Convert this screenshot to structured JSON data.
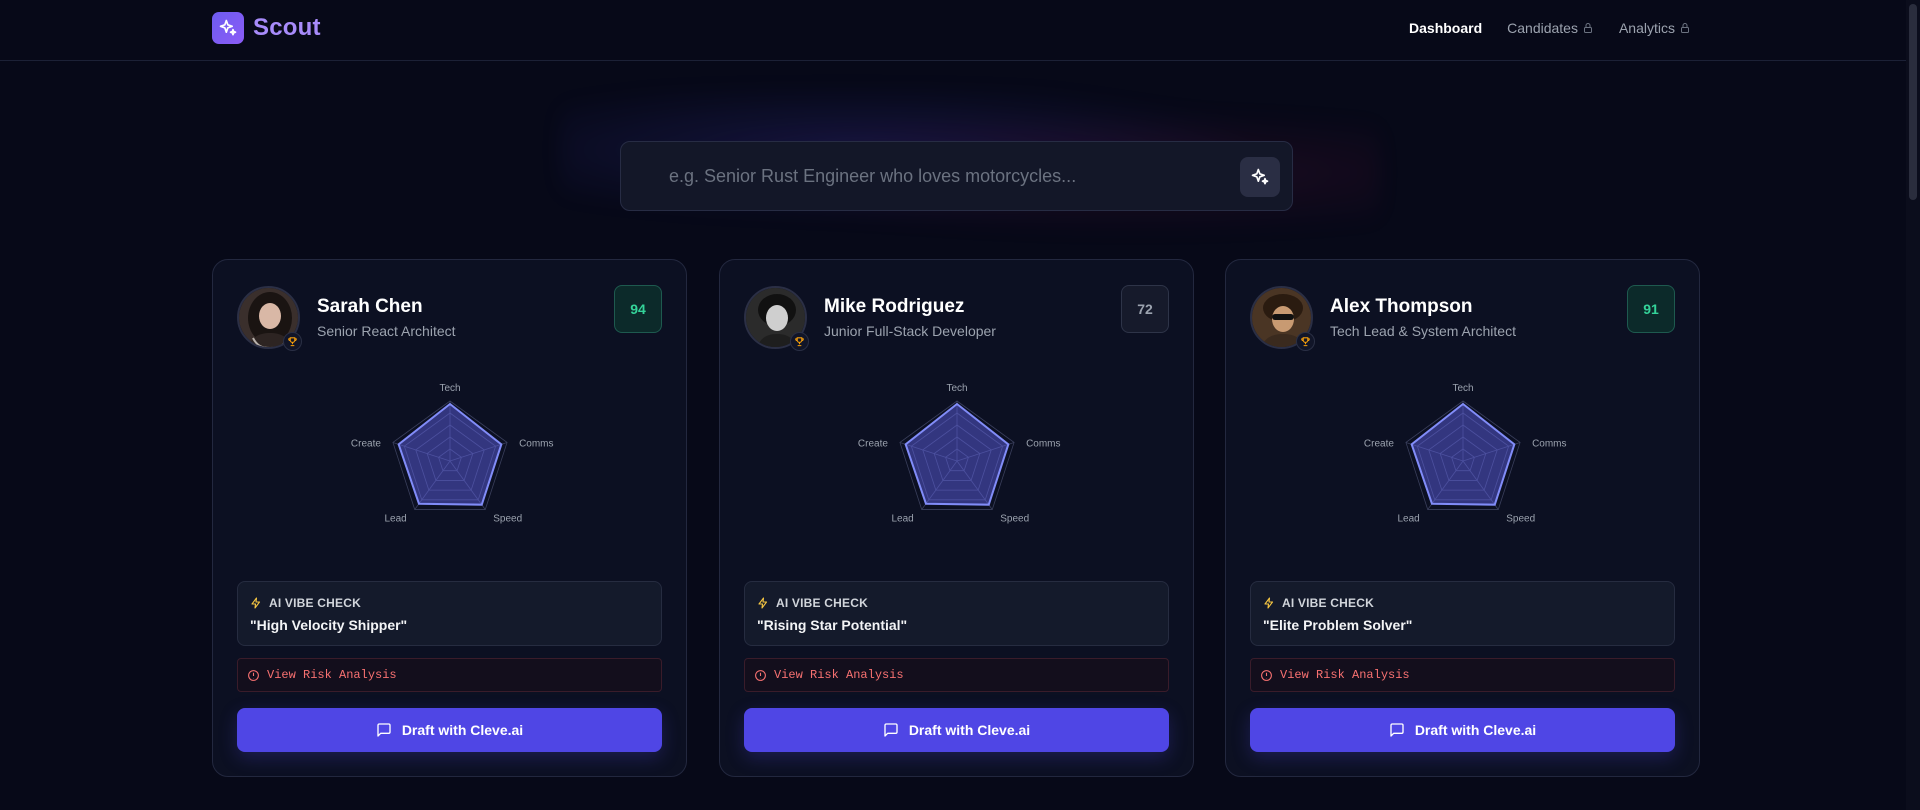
{
  "app": {
    "name": "Scout",
    "accent": "#4f46e5",
    "brand_color": "#a78bfa"
  },
  "nav": {
    "items": [
      {
        "label": "Dashboard",
        "active": true,
        "locked": false
      },
      {
        "label": "Candidates",
        "active": false,
        "locked": true
      },
      {
        "label": "Analytics",
        "active": false,
        "locked": true
      }
    ]
  },
  "search": {
    "placeholder": "e.g. Senior Rust Engineer who loves motorcycles...",
    "value": "",
    "button_icon": "sparkles-icon"
  },
  "radar_axes": [
    "Tech",
    "Comms",
    "Speed",
    "Lead",
    "Create"
  ],
  "candidates": [
    {
      "name": "Sarah Chen",
      "role": "Senior React Architect",
      "score": "94",
      "score_level": "high",
      "badge_icon": "trophy-icon",
      "skills": [
        0.95,
        0.9,
        0.9,
        0.88,
        0.9
      ],
      "vibe_label": "AI VIBE CHECK",
      "vibe_quote": "\"High Velocity Shipper\"",
      "risk_label": "View Risk Analysis",
      "draft_label": "Draft with Cleve.ai"
    },
    {
      "name": "Mike Rodriguez",
      "role": "Junior Full-Stack Developer",
      "score": "72",
      "score_level": "mid",
      "badge_icon": "trophy-icon",
      "skills": [
        0.95,
        0.9,
        0.9,
        0.88,
        0.9
      ],
      "vibe_label": "AI VIBE CHECK",
      "vibe_quote": "\"Rising Star Potential\"",
      "risk_label": "View Risk Analysis",
      "draft_label": "Draft with Cleve.ai"
    },
    {
      "name": "Alex Thompson",
      "role": "Tech Lead & System Architect",
      "score": "91",
      "score_level": "high",
      "badge_icon": "trophy-icon",
      "skills": [
        0.95,
        0.9,
        0.9,
        0.88,
        0.9
      ],
      "vibe_label": "AI VIBE CHECK",
      "vibe_quote": "\"Elite Problem Solver\"",
      "risk_label": "View Risk Analysis",
      "draft_label": "Draft with Cleve.ai"
    }
  ]
}
